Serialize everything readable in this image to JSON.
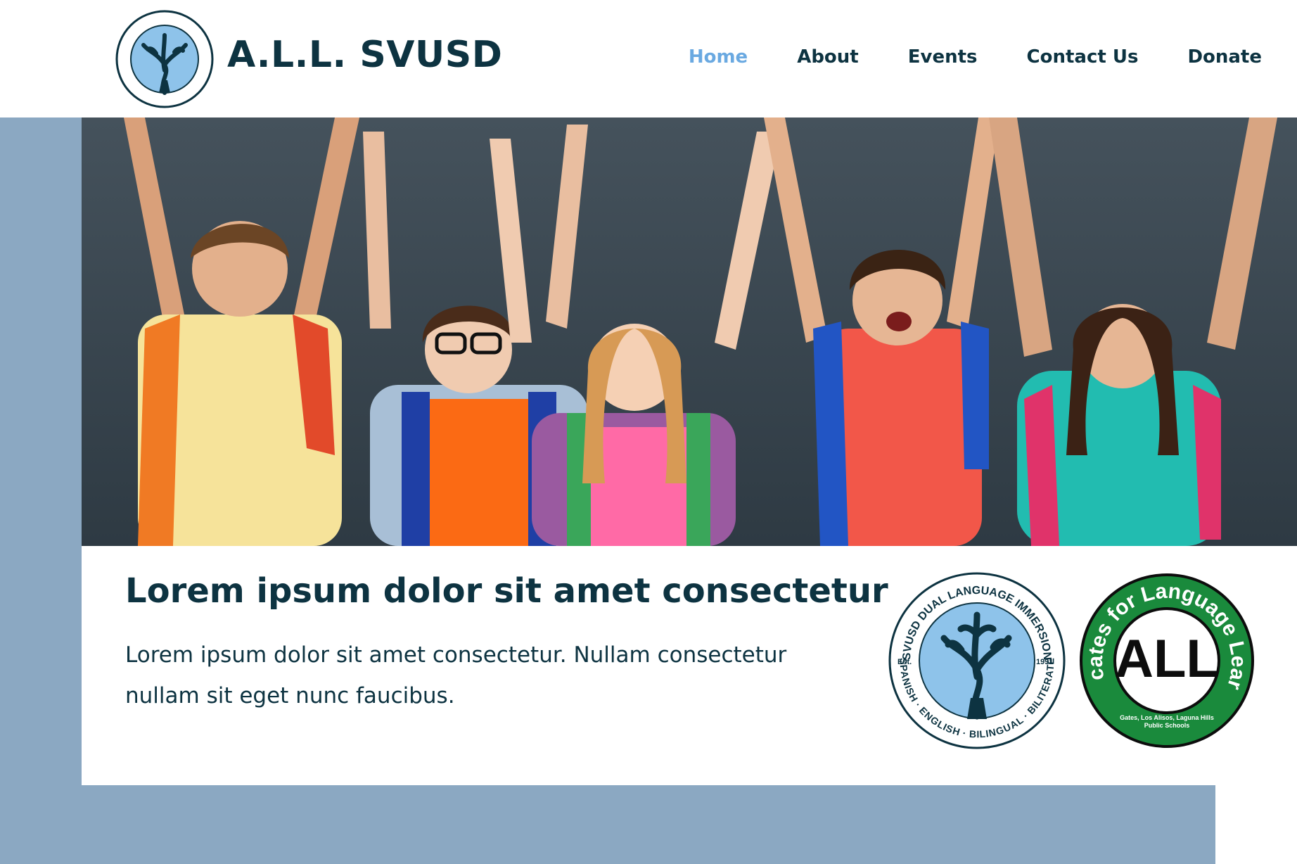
{
  "site": {
    "brand": "A.L.L. SVUSD"
  },
  "nav": {
    "items": [
      {
        "label": "Home",
        "active": true
      },
      {
        "label": "About",
        "active": false
      },
      {
        "label": "Events",
        "active": false
      },
      {
        "label": "Contact Us",
        "active": false
      },
      {
        "label": "Donate",
        "active": false
      }
    ]
  },
  "hero": {
    "image_semantic": "children-raising-hands-photo"
  },
  "main": {
    "heading": "Lorem ipsum dolor sit amet consectetur",
    "body": "Lorem ipsum dolor sit amet consectetur. Nullam consectetur nullam sit eget nunc faucibus."
  },
  "badges": {
    "svusd": {
      "top_text": "SVUSD DUAL LANGUAGE IMMERSION",
      "bottom_text": "SPANISH · ENGLISH · BILINGUAL · BILITERATE",
      "est_label": "Est.",
      "year": "1991"
    },
    "all": {
      "ring_text": "Advocates for Language Learning",
      "center_text": "ALL",
      "footer_line1": "Gates, Los Alisos, Laguna Hills",
      "footer_line2": "Public Schools"
    }
  },
  "colors": {
    "brand_dark": "#0d3341",
    "nav_active": "#6aa9e1",
    "panel_blue": "#8ba8c2",
    "badge_green": "#1a8a3c"
  }
}
